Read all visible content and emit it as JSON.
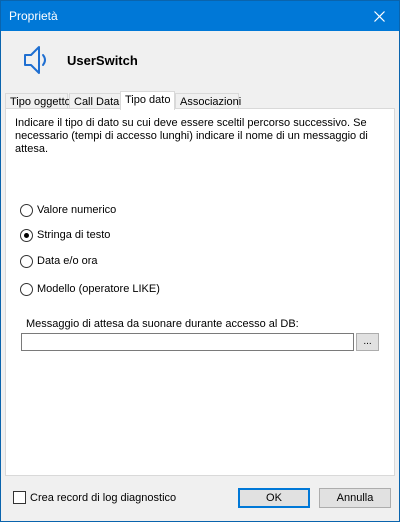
{
  "window": {
    "title": "Proprietà"
  },
  "header": {
    "name": "UserSwitch",
    "icon": "speaker-icon"
  },
  "tabs": [
    {
      "label": "Tipo oggetto",
      "active": false
    },
    {
      "label": "Call Data",
      "active": false
    },
    {
      "label": "Tipo dato",
      "active": true
    },
    {
      "label": "Associazioni",
      "active": false
    }
  ],
  "panel": {
    "description": "Indicare il tipo di dato su cui deve essere sceltil percorso successivo. Se necessario (tempi di accesso lunghi) indicare il nome di un messaggio di attesa.",
    "options": [
      {
        "label": "Valore numerico",
        "checked": false
      },
      {
        "label": "Stringa di testo",
        "checked": true
      },
      {
        "label": "Data e/o ora",
        "checked": false
      },
      {
        "label": "Modello (operatore LIKE)",
        "checked": false
      }
    ],
    "message_label": "Messaggio di attesa da suonare durante accesso al DB:",
    "message_value": "",
    "browse_label": "..."
  },
  "footer": {
    "log_label": "Crea record di log diagnostico",
    "log_checked": false,
    "ok_label": "OK",
    "cancel_label": "Annulla"
  }
}
